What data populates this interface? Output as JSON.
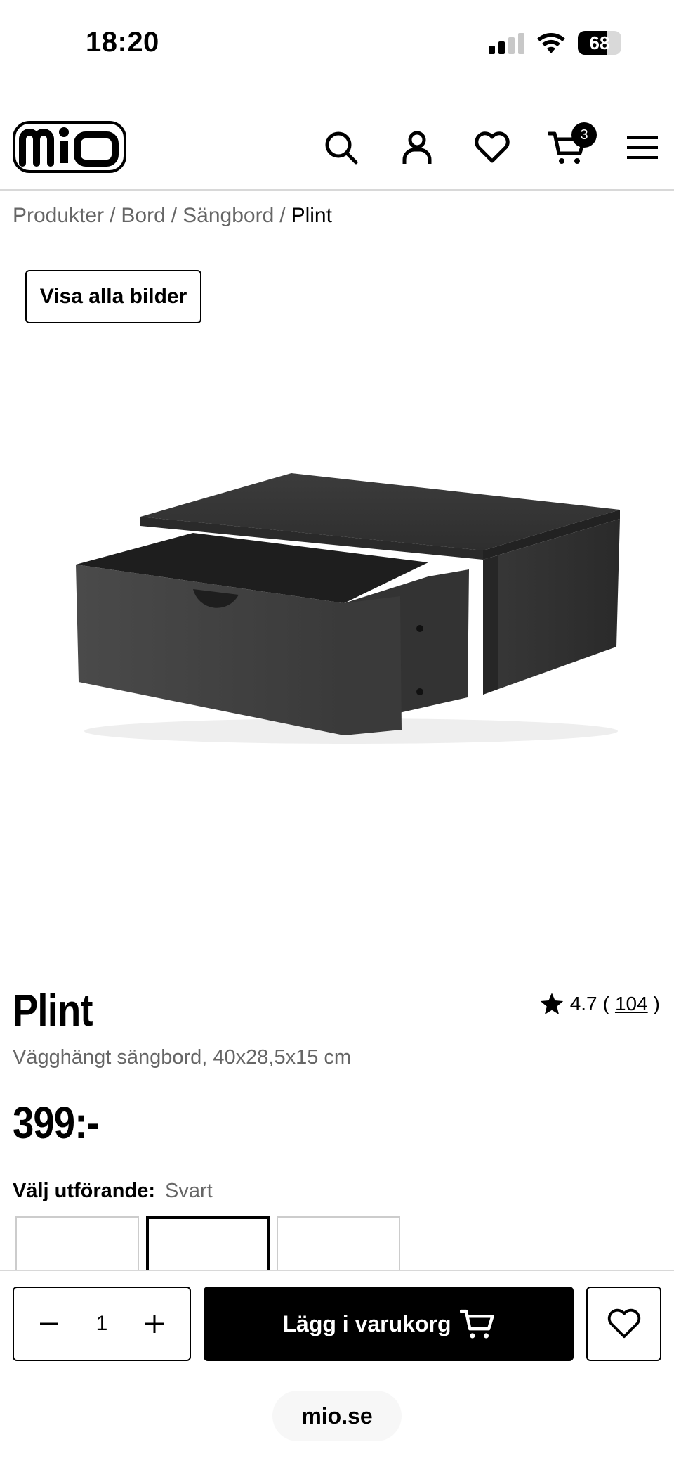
{
  "status_bar": {
    "time": "18:20",
    "battery": "68",
    "battery_level": 0.68
  },
  "header": {
    "logo_text": "mio",
    "cart_count": "3",
    "icons": [
      "search-icon",
      "user-icon",
      "heart-icon",
      "cart-icon",
      "menu-icon"
    ]
  },
  "breadcrumb": {
    "items": [
      "Produkter",
      "Bord",
      "Sängbord"
    ],
    "separator": "/",
    "current": "Plint"
  },
  "gallery": {
    "show_all_label": "Visa alla bilder"
  },
  "product": {
    "title": "Plint",
    "rating": "4.7",
    "review_count": "104",
    "subtitle": "Vägghängt sängbord, 40x28,5x15 cm",
    "price": "399:-",
    "variant_label": "Välj utförande:",
    "variant_value": "Svart",
    "colors": {
      "product": "#3a3a3a"
    }
  },
  "purchase": {
    "quantity": "1",
    "add_to_cart_label": "Lägg i varukorg"
  },
  "browser": {
    "url": "mio.se"
  }
}
